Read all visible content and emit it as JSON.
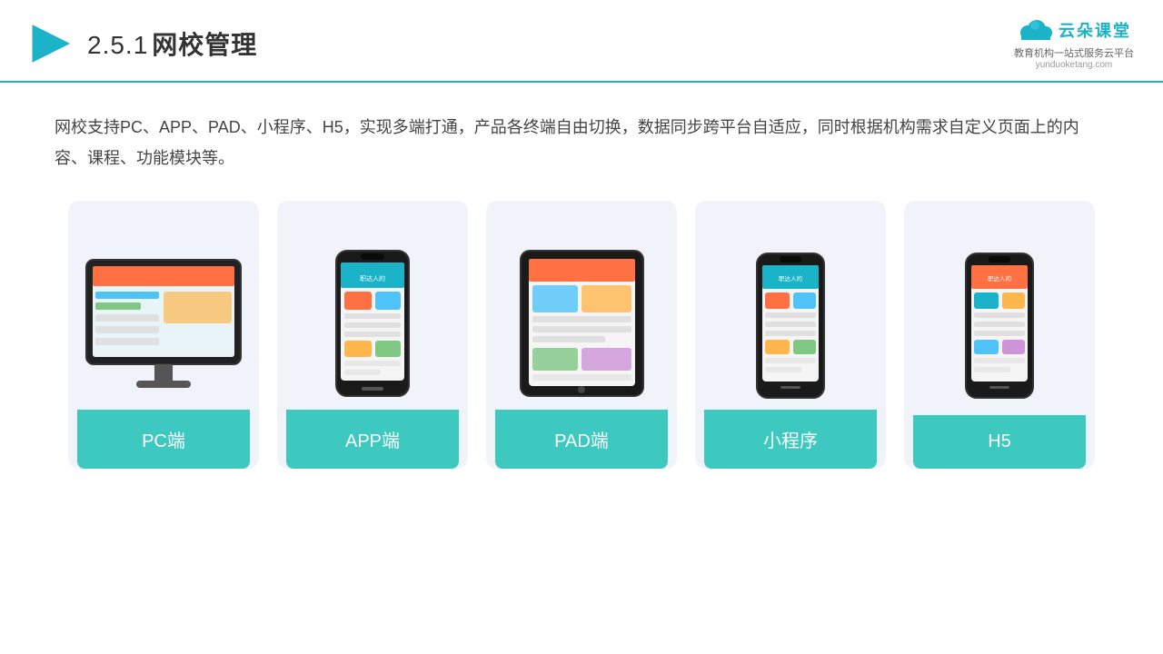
{
  "header": {
    "title_number": "2.5.1",
    "title_text": "网校管理",
    "accent_color": "#1ab3c8",
    "logo_text": "云朵课堂",
    "logo_url": "yunduoketang.com",
    "logo_subtitle_line1": "教育机构一站",
    "logo_subtitle_line2": "式服务云平台"
  },
  "description": {
    "text": "网校支持PC、APP、PAD、小程序、H5，实现多端打通，产品各终端自由切换，数据同步跨平台自适应，同时根据机构需求自定义页面上的内容、课程、功能模块等。"
  },
  "cards": [
    {
      "id": "pc",
      "label": "PC端",
      "device_type": "monitor"
    },
    {
      "id": "app",
      "label": "APP端",
      "device_type": "phone"
    },
    {
      "id": "pad",
      "label": "PAD端",
      "device_type": "tablet"
    },
    {
      "id": "miniprogram",
      "label": "小程序",
      "device_type": "phone"
    },
    {
      "id": "h5",
      "label": "H5",
      "device_type": "phone"
    }
  ],
  "teal_color": "#3dc8c0"
}
